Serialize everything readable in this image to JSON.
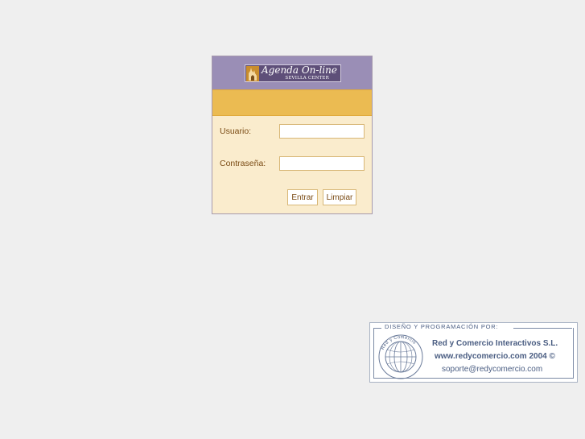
{
  "logo": {
    "title": "Agenda On-line",
    "subtitle": "SEVILLA CENTER"
  },
  "login": {
    "user_label": "Usuario:",
    "user_value": "",
    "password_label": "Contraseña:",
    "password_value": "",
    "submit_label": "Entrar",
    "clear_label": "Limpiar"
  },
  "credits": {
    "heading": "DISEÑO Y PROGRAMACIÓN POR:",
    "company": "Red y Comercio Interactivos S.L.",
    "website": "www.redycomercio.com 2004 ©",
    "email": "soporte@redycomercio.com",
    "seal_text": "Red y Comercio"
  },
  "colors": {
    "background": "#efefef",
    "header_purple": "#9a8eb6",
    "bar_orange": "#ebbb52",
    "panel_cream": "#faeccd",
    "label_brown": "#7a4b14",
    "credits_blue": "#4a5d82"
  }
}
